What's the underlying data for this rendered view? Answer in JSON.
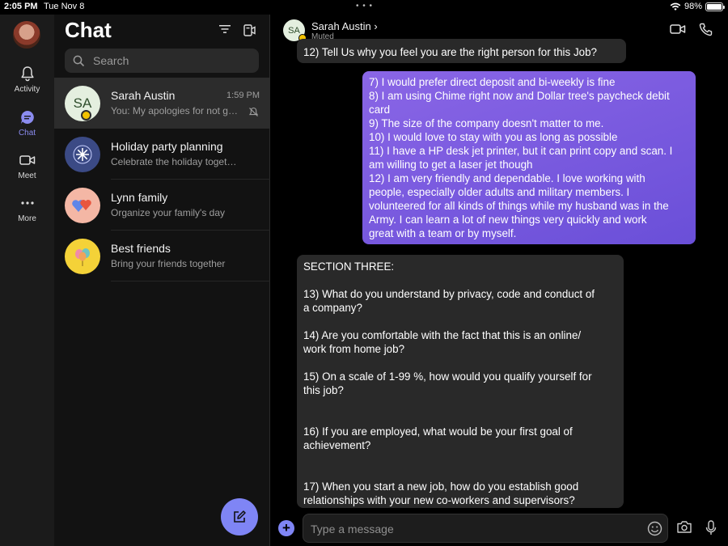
{
  "statusbar": {
    "time": "2:05 PM",
    "date": "Tue Nov 8",
    "battery_text": "98%",
    "battery_level": 0.98
  },
  "rail": {
    "items": [
      {
        "label": "Activity",
        "icon": "bell-icon"
      },
      {
        "label": "Chat",
        "icon": "chat-icon",
        "active": true
      },
      {
        "label": "Meet",
        "icon": "video-icon"
      },
      {
        "label": "More",
        "icon": "ellipsis-icon"
      }
    ]
  },
  "list": {
    "title": "Chat",
    "search_placeholder": "Search",
    "chats": [
      {
        "name": "Sarah Austin",
        "initials": "SA",
        "time": "1:59 PM",
        "preview": "You: My apologies for not getting back to you",
        "selected": true
      },
      {
        "name": "Holiday party planning",
        "preview": "Celebrate the holiday together"
      },
      {
        "name": "Lynn family",
        "preview": "Organize your family's day"
      },
      {
        "name": "Best friends",
        "preview": "Bring your friends together"
      }
    ]
  },
  "conversation": {
    "contact_initials": "SA",
    "contact_name": "Sarah Austin",
    "contact_status": "Muted",
    "messages": [
      {
        "dir": "in",
        "lines": [
          "12) Tell Us why you feel you are the right person for this Job?"
        ]
      },
      {
        "dir": "out",
        "lines": [
          "7) I would prefer direct deposit and bi-weekly is fine",
          "8) I am using Chime right now and Dollar tree's paycheck debit",
          "card",
          "9) The size of the company doesn't matter to me.",
          "10) I would love to stay with you as long as possible",
          "11) I have a HP desk jet printer, but it can print copy and scan. I",
          "am willing to get a laser jet though",
          "12) I am very friendly and dependable. I love working with",
          "people, especially older adults and military members. I",
          "volunteered for all kinds of things while my husband was in the",
          "Army. I can learn a lot of new things very quickly and work",
          "great with a team or by myself."
        ]
      },
      {
        "dir": "in",
        "lines": [
          "SECTION THREE:",
          "",
          "13) What do you understand by privacy, code and conduct of",
          "a company?",
          "",
          "14) Are you comfortable with the fact that this is an online/",
          "work from home job?",
          "",
          "15) On a scale of 1-99 %, how would you qualify yourself for",
          "this job?",
          "",
          "",
          "16) If you are employed, what would be your first goal of",
          "achievement?",
          "",
          "",
          "17) When you start a new job, how do you establish good",
          "relationships with your new co-workers and supervisors?"
        ]
      }
    ],
    "composer_placeholder": "Type a message"
  },
  "colors": {
    "accent": "#7f85f5",
    "bubble_out": "#7a5be0",
    "bubble_in": "#292929"
  }
}
